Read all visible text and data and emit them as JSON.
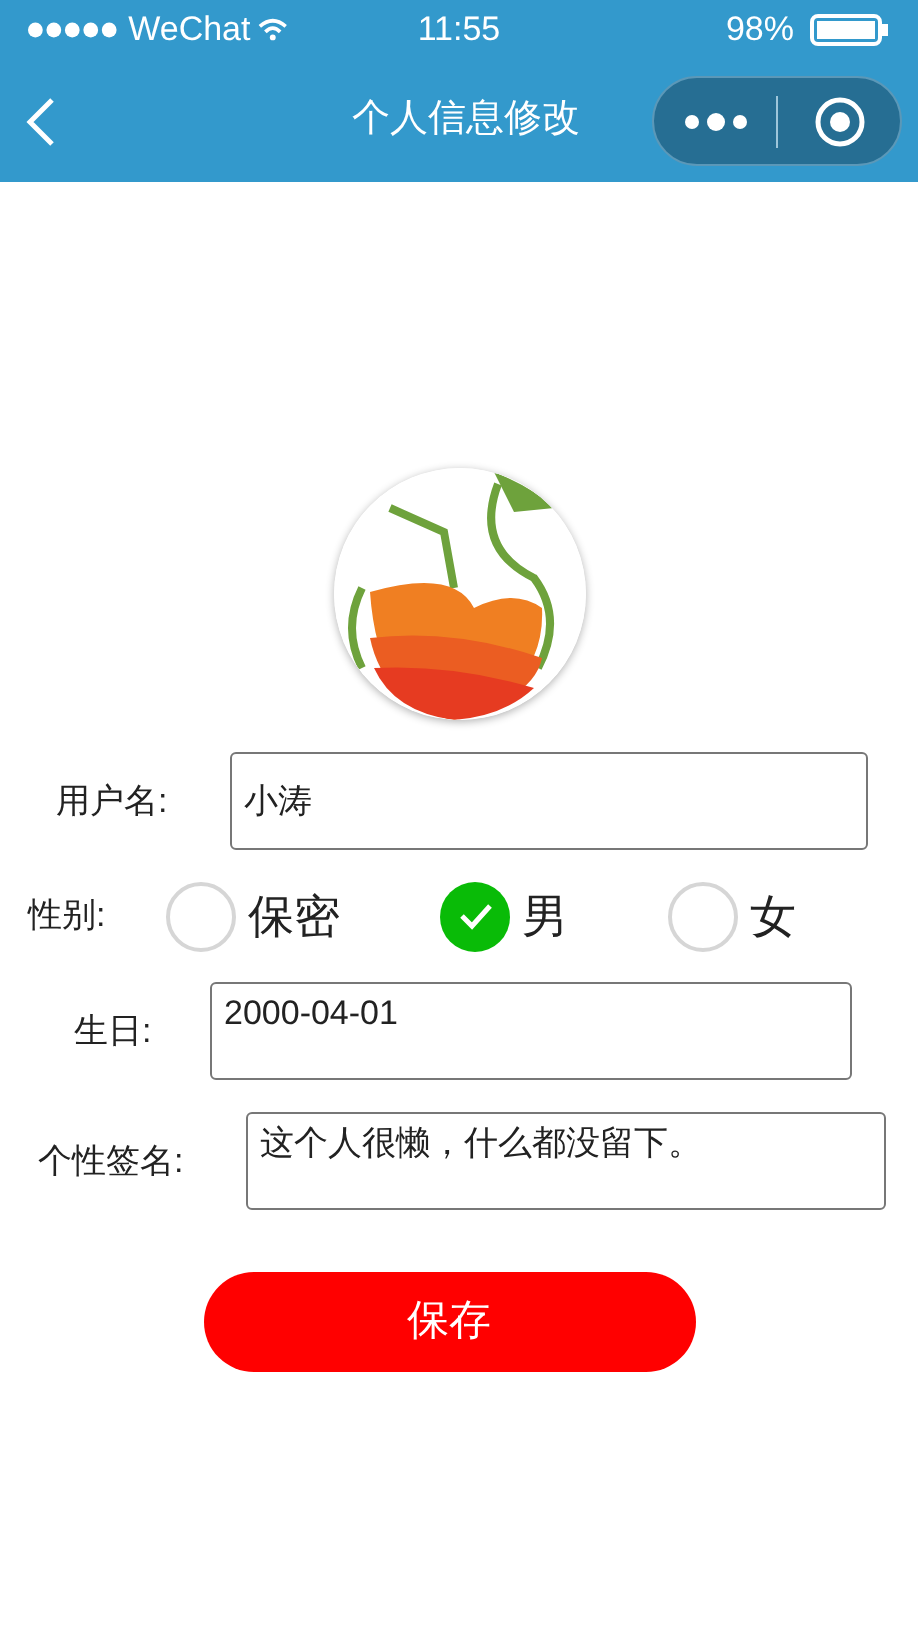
{
  "status_bar": {
    "carrier": "WeChat",
    "time": "11:55",
    "battery": "98%"
  },
  "nav_bar": {
    "title": "个人信息修改"
  },
  "form": {
    "rows": [
      {
        "kind": "text",
        "label": "用户名:",
        "value": "小涛"
      },
      {
        "kind": "radio",
        "label": "性别:",
        "options": [
          {
            "label": "保密",
            "selected": false
          },
          {
            "label": "男",
            "selected": true
          },
          {
            "label": "女",
            "selected": false
          }
        ]
      },
      {
        "kind": "area",
        "label": "生日:",
        "value": "2000-04-01"
      },
      {
        "kind": "area",
        "label": "个性签名:",
        "value": "这个人很懒，什么都没留下。"
      }
    ]
  },
  "save_button": "保存"
}
